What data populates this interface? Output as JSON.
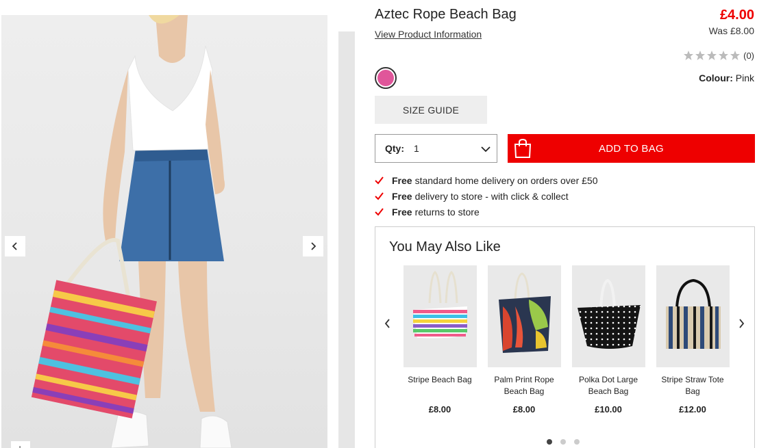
{
  "product": {
    "title": "Aztec Rope Beach Bag",
    "view_info_link": "View Product Information",
    "price": "£4.00",
    "was_price": "Was £8.00",
    "rating_count": "(0)",
    "stars": 0,
    "colour_label": "Colour:",
    "colour_value": "Pink",
    "swatch_color": "#e0569a",
    "size_guide": "SIZE GUIDE",
    "qty_label": "Qty:",
    "qty_value": "1",
    "add_to_bag": "ADD TO BAG"
  },
  "perks": [
    {
      "bold": "Free",
      "text": "standard home delivery on orders over £50"
    },
    {
      "bold": "Free",
      "text": "delivery to store - with click & collect"
    },
    {
      "bold": "Free",
      "text": "returns to store"
    }
  ],
  "ymal": {
    "title": "You May Also Like",
    "items": [
      {
        "name": "Stripe Beach Bag",
        "price": "£8.00"
      },
      {
        "name": "Palm Print Rope Beach Bag",
        "price": "£8.00"
      },
      {
        "name": "Polka Dot Large Beach Bag",
        "price": "£10.00"
      },
      {
        "name": "Stripe Straw Tote Bag",
        "price": "£12.00"
      }
    ],
    "pagination_total": 3,
    "pagination_active": 1
  },
  "gallery": {
    "zoom_symbol": "+"
  },
  "colors": {
    "accent_red": "#e00000",
    "check_red": "#e00000"
  }
}
